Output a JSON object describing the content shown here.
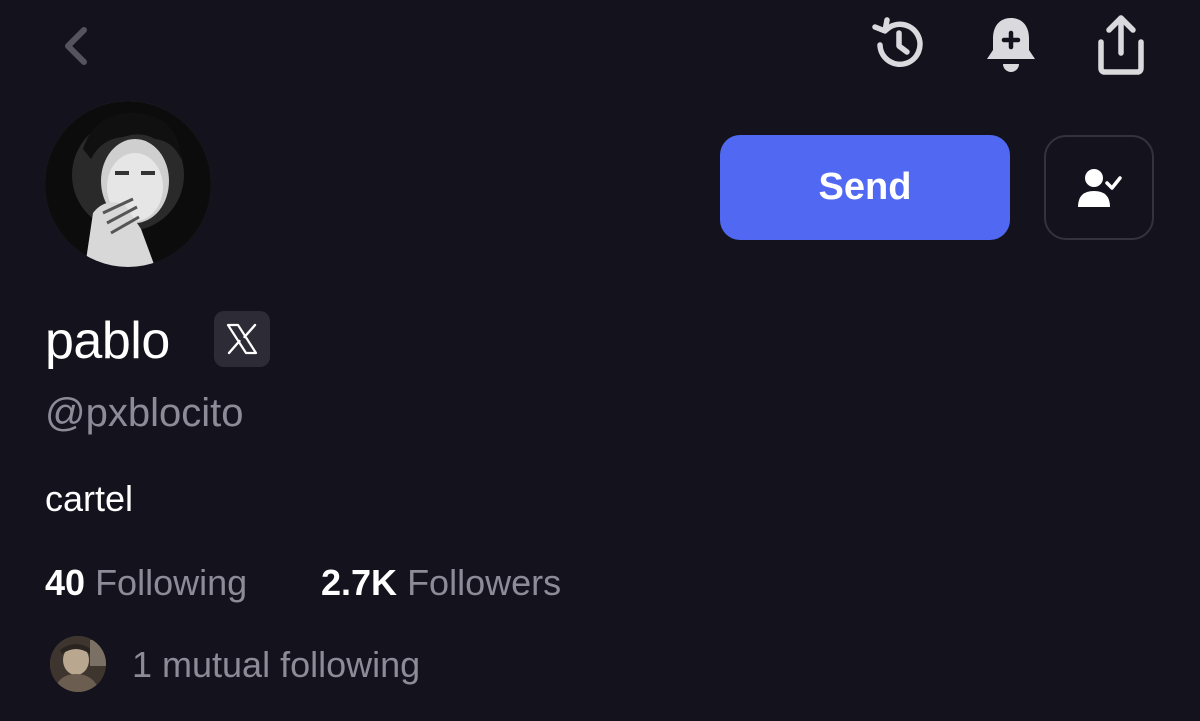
{
  "nav": {
    "back_icon": "chevron-left-icon",
    "history_icon": "history-icon",
    "bell_icon": "bell-plus-icon",
    "share_icon": "share-icon"
  },
  "profile": {
    "display_name": "pablo",
    "platform_badge": "𝕏",
    "handle": "@pxblocito",
    "bio": "cartel",
    "avatar_description": "black-and-white portrait photo"
  },
  "actions": {
    "send_label": "Send",
    "follow_icon": "user-check-icon"
  },
  "stats": {
    "following_count": "40",
    "following_label": "Following",
    "followers_count": "2.7K",
    "followers_label": "Followers"
  },
  "mutual": {
    "text": "1 mutual following"
  },
  "colors": {
    "background": "#14121c",
    "accent": "#5168f2",
    "muted_text": "#8d8b98",
    "icon": "#d9d9de"
  }
}
